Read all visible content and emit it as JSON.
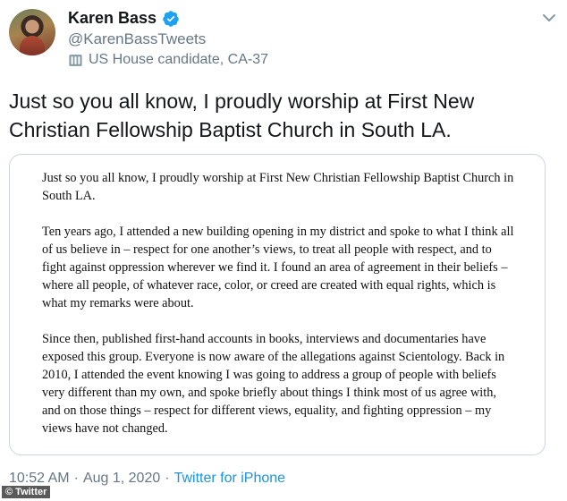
{
  "user": {
    "display_name": "Karen Bass",
    "handle": "@KarenBassTweets",
    "label": "US House candidate, CA-37",
    "verified": true
  },
  "tweet": {
    "text": "Just so you all know, I proudly worship at First New Christian Fellowship Baptist Church in South LA."
  },
  "image_card": {
    "paragraphs": [
      "Just so you all know, I proudly worship at First New Christian Fellowship Baptist Church in South LA.",
      "Ten years ago, I attended a new building opening in my district and spoke to what I think all of us believe in – respect for one another’s views, to treat all people with respect, and to fight against oppression wherever we find it. I found an area of agreement in their beliefs – where all people, of whatever race, color, or creed are created with equal rights, which is what my remarks were about.",
      "Since then, published first-hand accounts in books, interviews and documentaries have exposed this group. Everyone is now aware of the allegations against Scientology. Back in 2010, I attended the event knowing I was going to address a group of people with beliefs very different than my own, and spoke briefly about things I think most of us agree with, and on those things – respect for different views, equality, and fighting oppression – my views have not changed."
    ]
  },
  "meta": {
    "time": "10:52 AM",
    "separator1": "·",
    "date": "Aug 1, 2020",
    "separator2": "·",
    "source": "Twitter for iPhone"
  },
  "credit": "© Twitter",
  "colors": {
    "verified_blue": "#1da1f2",
    "secondary_text": "#657786",
    "link_blue": "#1b95e0"
  },
  "icons": {
    "verified": "verified-badge-icon",
    "label": "government-building-icon",
    "more": "chevron-down-icon"
  }
}
